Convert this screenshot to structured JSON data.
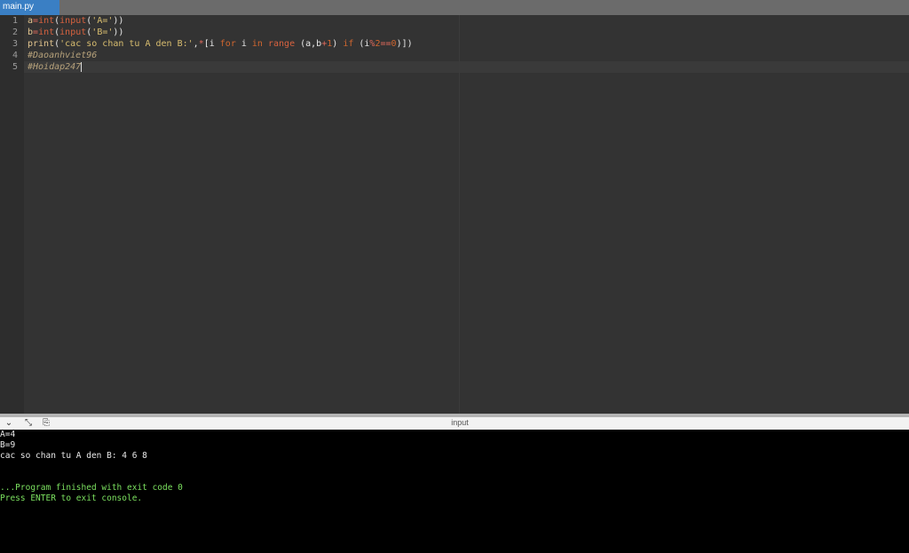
{
  "tabs": [
    {
      "label": "main.py",
      "active": true
    }
  ],
  "editor": {
    "line_numbers": [
      "1",
      "2",
      "3",
      "4",
      "5"
    ],
    "lines": [
      [
        {
          "t": "a",
          "c": "id"
        },
        {
          "t": "=",
          "c": "op"
        },
        {
          "t": "int",
          "c": "fn"
        },
        {
          "t": "(",
          "c": "pl"
        },
        {
          "t": "input",
          "c": "fn"
        },
        {
          "t": "(",
          "c": "pl"
        },
        {
          "t": "'A='",
          "c": "str"
        },
        {
          "t": "))",
          "c": "pl"
        }
      ],
      [
        {
          "t": "b",
          "c": "id"
        },
        {
          "t": "=",
          "c": "op"
        },
        {
          "t": "int",
          "c": "fn"
        },
        {
          "t": "(",
          "c": "pl"
        },
        {
          "t": "input",
          "c": "fn"
        },
        {
          "t": "(",
          "c": "pl"
        },
        {
          "t": "'B='",
          "c": "str"
        },
        {
          "t": "))",
          "c": "pl"
        }
      ],
      [
        {
          "t": "print",
          "c": "id"
        },
        {
          "t": "(",
          "c": "pl"
        },
        {
          "t": "'cac so chan tu A den B:'",
          "c": "str"
        },
        {
          "t": ",",
          "c": "pl"
        },
        {
          "t": "*",
          "c": "op"
        },
        {
          "t": "[i ",
          "c": "pl"
        },
        {
          "t": "for",
          "c": "kw"
        },
        {
          "t": " i ",
          "c": "pl"
        },
        {
          "t": "in",
          "c": "kw"
        },
        {
          "t": " ",
          "c": "pl"
        },
        {
          "t": "range",
          "c": "fn"
        },
        {
          "t": " (a,b",
          "c": "pl"
        },
        {
          "t": "+",
          "c": "op"
        },
        {
          "t": "1",
          "c": "num"
        },
        {
          "t": ") ",
          "c": "pl"
        },
        {
          "t": "if",
          "c": "kw"
        },
        {
          "t": " (i",
          "c": "pl"
        },
        {
          "t": "%",
          "c": "op"
        },
        {
          "t": "2",
          "c": "num"
        },
        {
          "t": "==",
          "c": "op"
        },
        {
          "t": "0",
          "c": "num"
        },
        {
          "t": ")])",
          "c": "pl"
        }
      ],
      [
        {
          "t": "#Daoanhviet96",
          "c": "com"
        }
      ],
      [
        {
          "t": "#Hoidap247",
          "c": "com"
        }
      ]
    ]
  },
  "console": {
    "title": "input",
    "icons": [
      "chevron-down-icon",
      "expand-icon",
      "copy-icon"
    ],
    "output": [
      {
        "text": "A=4",
        "color": "white"
      },
      {
        "text": "B=9",
        "color": "white"
      },
      {
        "text": "cac so chan tu A den B: 4 6 8",
        "color": "white"
      },
      {
        "text": "",
        "color": "white"
      },
      {
        "text": "",
        "color": "white"
      },
      {
        "text": "...Program finished with exit code 0",
        "color": "green"
      },
      {
        "text": "Press ENTER to exit console.",
        "color": "green"
      }
    ]
  },
  "colors": {
    "tab_active": "#3a7fc4",
    "editor_bg": "#333333",
    "console_bg": "#000000",
    "console_green": "#7be05f"
  }
}
